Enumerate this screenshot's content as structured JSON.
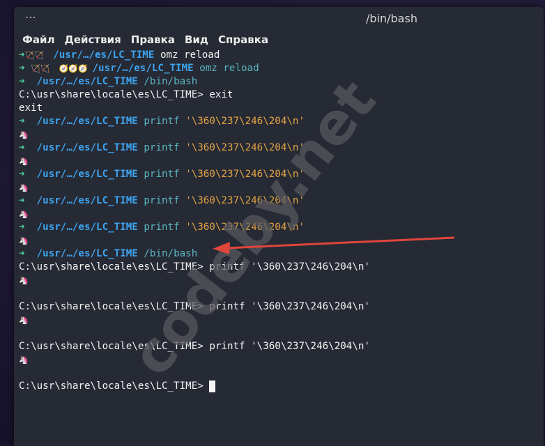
{
  "window": {
    "title": "/bin/bash",
    "dots": "⋯"
  },
  "menu": [
    "Файл",
    "Действия",
    "Правка",
    "Вид",
    "Справка"
  ],
  "lines": [
    [
      {
        "t": "➜",
        "c": "arrow"
      },
      {
        "t": "🏹🏹  ",
        "c": "emoji"
      },
      {
        "t": "/usr/…/es/LC_TIME",
        "c": "path"
      },
      {
        "t": " omz reload",
        "c": "plain"
      }
    ],
    [
      {
        "t": "➜ ",
        "c": "arrow"
      },
      {
        "t": "🏹🏹  🧭🧭🧭 ",
        "c": "emoji"
      },
      {
        "t": "/usr/…/es/LC_TIME",
        "c": "path"
      },
      {
        "t": " omz reload",
        "c": "cmd-cyan"
      }
    ],
    [
      {
        "t": "➜  ",
        "c": "arrow"
      },
      {
        "t": "/usr/…/es/LC_TIME",
        "c": "path"
      },
      {
        "t": " /bin/bash",
        "c": "cmd-cyan"
      }
    ],
    [
      {
        "t": "C:\\usr\\share\\locale\\es\\LC_TIME> exit",
        "c": "plain"
      }
    ],
    [
      {
        "t": "exit",
        "c": "plain"
      }
    ],
    [
      {
        "t": "➜  ",
        "c": "arrow"
      },
      {
        "t": "/usr/…/es/LC_TIME",
        "c": "path"
      },
      {
        "t": " printf ",
        "c": "cmd-cyan"
      },
      {
        "t": "'\\360\\237\\246\\204\\n'",
        "c": "str"
      }
    ],
    [
      {
        "t": "🦄",
        "c": "emoji"
      }
    ],
    [
      {
        "t": "➜  ",
        "c": "arrow"
      },
      {
        "t": "/usr/…/es/LC_TIME",
        "c": "path"
      },
      {
        "t": " printf ",
        "c": "cmd-cyan"
      },
      {
        "t": "'\\360\\237\\246\\204\\n'",
        "c": "str"
      }
    ],
    [
      {
        "t": "🦄",
        "c": "emoji"
      }
    ],
    [
      {
        "t": "➜  ",
        "c": "arrow"
      },
      {
        "t": "/usr/…/es/LC_TIME",
        "c": "path"
      },
      {
        "t": " printf ",
        "c": "cmd-cyan"
      },
      {
        "t": "'\\360\\237\\246\\204\\n'",
        "c": "str"
      }
    ],
    [
      {
        "t": "🦄",
        "c": "emoji"
      }
    ],
    [
      {
        "t": "➜  ",
        "c": "arrow"
      },
      {
        "t": "/usr/…/es/LC_TIME",
        "c": "path"
      },
      {
        "t": " printf ",
        "c": "cmd-cyan"
      },
      {
        "t": "'\\360\\237\\246\\204\\n'",
        "c": "str"
      }
    ],
    [
      {
        "t": "🦄",
        "c": "emoji"
      }
    ],
    [
      {
        "t": "➜  ",
        "c": "arrow"
      },
      {
        "t": "/usr/…/es/LC_TIME",
        "c": "path"
      },
      {
        "t": " printf ",
        "c": "cmd-cyan"
      },
      {
        "t": "'\\360\\237\\246\\204\\n'",
        "c": "str"
      }
    ],
    [
      {
        "t": "🦄",
        "c": "emoji"
      }
    ],
    [
      {
        "t": "➜  ",
        "c": "arrow"
      },
      {
        "t": "/usr/…/es/LC_TIME",
        "c": "path"
      },
      {
        "t": " /bin/bash",
        "c": "cmd-cyan"
      }
    ],
    [
      {
        "t": "C:\\usr\\share\\locale\\es\\LC_TIME> printf '\\360\\237\\246\\204\\n'",
        "c": "plain"
      }
    ],
    [
      {
        "t": "🦄",
        "c": "emoji"
      }
    ],
    [],
    [
      {
        "t": "C:\\usr\\share\\locale\\es\\LC_TIME> printf '\\360\\237\\246\\204\\n'",
        "c": "plain"
      }
    ],
    [
      {
        "t": "🦄",
        "c": "emoji"
      }
    ],
    [],
    [
      {
        "t": "C:\\usr\\share\\locale\\es\\LC_TIME> printf '\\360\\237\\246\\204\\n'",
        "c": "plain"
      }
    ],
    [
      {
        "t": "🦄",
        "c": "emoji"
      }
    ],
    [],
    [
      {
        "t": "C:\\usr\\share\\locale\\es\\LC_TIME> ",
        "c": "plain"
      },
      {
        "cursor": true
      }
    ]
  ],
  "watermark": "codeby.net",
  "colors": {
    "annotation_arrow": "#e0453c"
  }
}
